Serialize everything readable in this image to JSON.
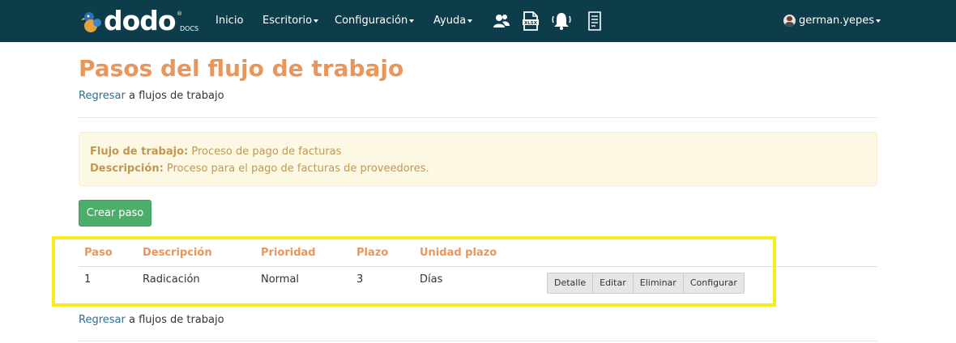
{
  "brand": {
    "logo_text": "dodo",
    "logo_subtext": "DOCS",
    "logo_registered": "®"
  },
  "nav": {
    "items": [
      {
        "label": "Inicio",
        "dropdown": false
      },
      {
        "label": "Escritorio",
        "dropdown": true
      },
      {
        "label": "Configuración",
        "dropdown": true
      },
      {
        "label": "Ayuda",
        "dropdown": true
      }
    ],
    "icons": [
      "users-icon",
      "xlsx-file-icon",
      "bell-icon",
      "document-list-icon"
    ],
    "user": "german.yepes"
  },
  "page": {
    "title": "Pasos del flujo de trabajo",
    "back_link": "Regresar",
    "back_text": " a flujos de trabajo"
  },
  "info": {
    "workflow_label": "Flujo de trabajo:",
    "workflow_value": " Proceso de pago de facturas",
    "description_label": "Descripción:",
    "description_value": " Proceso para el pago de facturas de proveedores."
  },
  "create_button": "Crear paso",
  "table": {
    "headers": [
      "Paso",
      "Descripción",
      "Prioridad",
      "Plazo",
      "Unidad plazo"
    ],
    "rows": [
      {
        "cells": [
          "1",
          "Radicación",
          "Normal",
          "3",
          "Días"
        ],
        "actions": [
          "Detalle",
          "Editar",
          "Eliminar",
          "Configurar"
        ]
      }
    ]
  },
  "colors": {
    "navbar": "#0d3c4b",
    "accent_orange": "#e8965a",
    "link": "#2a6f97",
    "success": "#4cae6b",
    "alert_bg": "#fcf8e3",
    "alert_text": "#c09853",
    "highlight": "#f7ec1a"
  }
}
